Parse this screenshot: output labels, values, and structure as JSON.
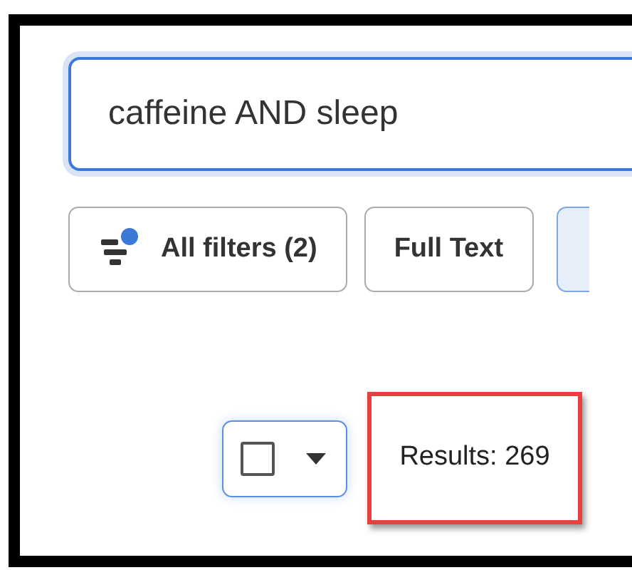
{
  "search": {
    "value": "caffeine AND sleep",
    "focused": true
  },
  "filters": [
    {
      "kind": "all",
      "label": "All filters (2)",
      "selected": false,
      "badge": true
    },
    {
      "kind": "plain",
      "label": "Full Text",
      "selected": false
    },
    {
      "kind": "plain",
      "selected": true
    }
  ],
  "select_all": {
    "checked": false
  },
  "results": {
    "text": "Results: 269",
    "highlighted": true
  }
}
